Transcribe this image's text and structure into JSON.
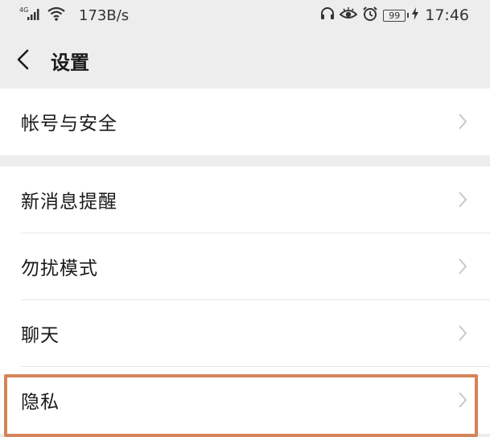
{
  "status_bar": {
    "network_type": "4G",
    "net_speed": "173B/s",
    "battery": "99",
    "time": "17:46"
  },
  "nav": {
    "title": "设置"
  },
  "settings": {
    "group1": [
      {
        "label": "帐号与安全"
      }
    ],
    "group2": [
      {
        "label": "新消息提醒"
      },
      {
        "label": "勿扰模式"
      },
      {
        "label": "聊天"
      },
      {
        "label": "隐私"
      }
    ]
  },
  "colors": {
    "background": "#ededed",
    "highlight_border": "#d4845a"
  }
}
